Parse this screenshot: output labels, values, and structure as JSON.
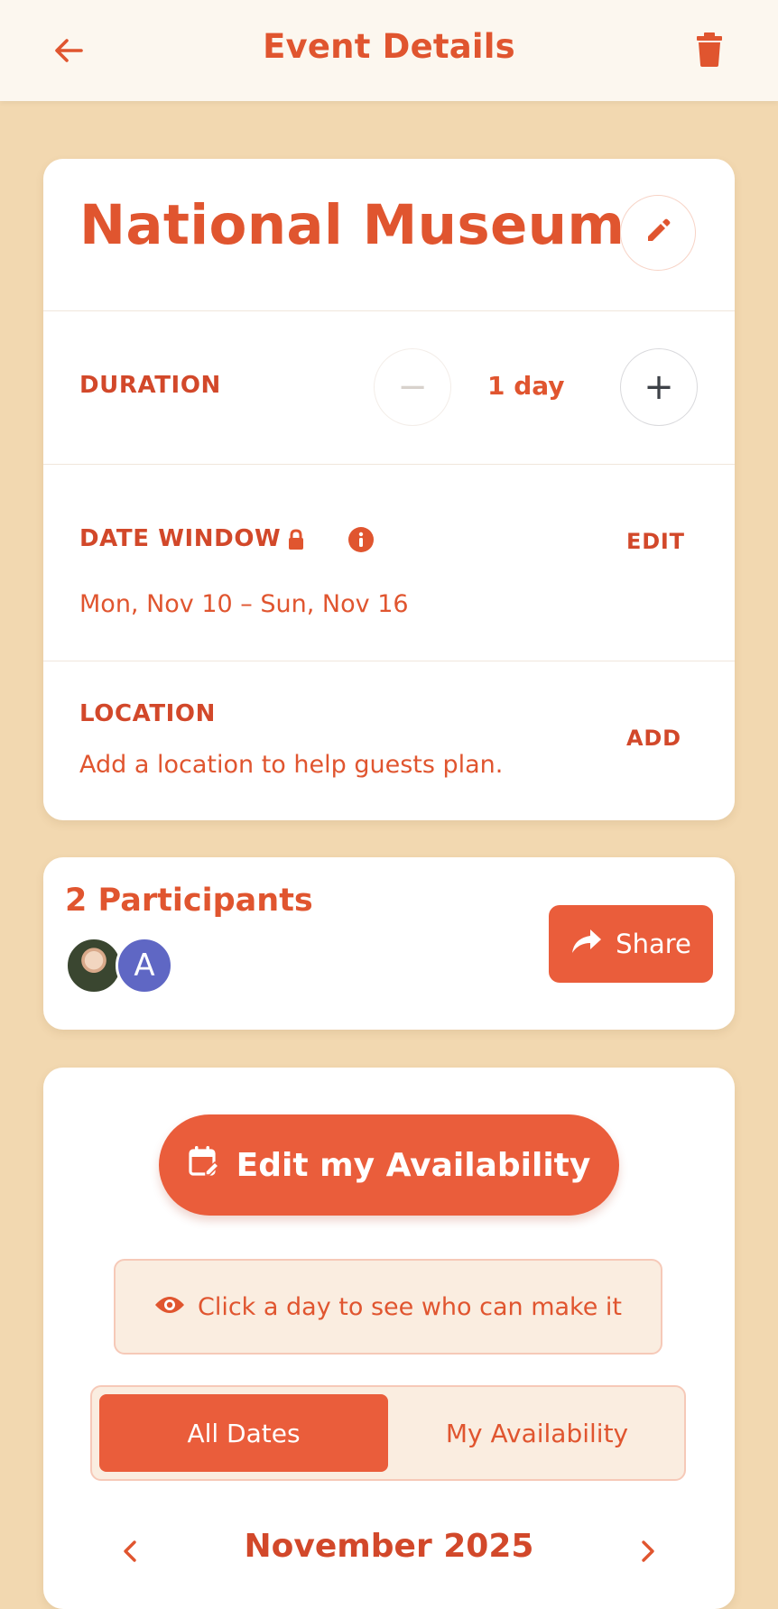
{
  "header": {
    "title": "Event Details",
    "back_icon": "arrow-left-icon",
    "delete_icon": "trash-icon"
  },
  "event": {
    "name": "National Museum",
    "edit_icon": "pencil-icon",
    "duration": {
      "label": "DURATION",
      "value": "1 day",
      "decrement": "−",
      "increment": "+"
    },
    "date_window": {
      "label": "DATE WINDOW",
      "lock_icon": "lock-icon",
      "info_icon": "info-icon",
      "action": "EDIT",
      "value": "Mon, Nov 10 – Sun, Nov 16"
    },
    "location": {
      "label": "LOCATION",
      "action": "ADD",
      "placeholder": "Add a location to help guests plan."
    }
  },
  "participants": {
    "title": "2 Participants",
    "avatars": [
      {
        "type": "photo"
      },
      {
        "type": "initial",
        "initial": "A",
        "color": "#5f67c4"
      }
    ],
    "share_label": "Share",
    "share_icon": "share-arrow-icon"
  },
  "availability": {
    "edit_label": "Edit my Availability",
    "edit_icon": "calendar-edit-icon",
    "hint": "Click a day to see who can make it",
    "hint_icon": "eye-icon",
    "tabs": [
      {
        "label": "All Dates",
        "active": true
      },
      {
        "label": "My Availability",
        "active": false
      }
    ],
    "month": "November 2025"
  },
  "colors": {
    "accent": "#ea5d3b",
    "text_accent": "#e0552f",
    "background": "#f2d8b0"
  }
}
